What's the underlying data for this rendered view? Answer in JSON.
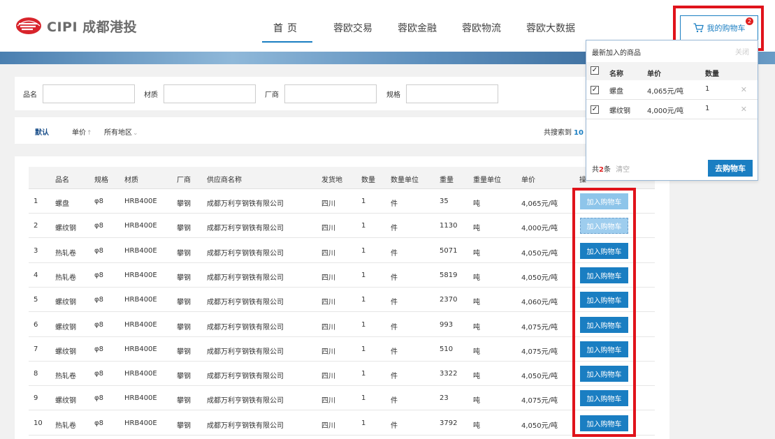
{
  "brand": {
    "name": "CIPI 成都港投"
  },
  "nav": {
    "items": [
      "首页",
      "蓉欧交易",
      "蓉欧金融",
      "蓉欧物流",
      "蓉欧大数据"
    ]
  },
  "cart": {
    "label": "我的购物车",
    "count": "2"
  },
  "search": {
    "fields": [
      {
        "label": "品名",
        "value": ""
      },
      {
        "label": "材质",
        "value": ""
      },
      {
        "label": "厂商",
        "value": ""
      },
      {
        "label": "规格",
        "value": ""
      }
    ]
  },
  "sort": {
    "default": "默认",
    "price": "单价",
    "region": "所有地区",
    "count_prefix": "共搜索到",
    "count": "10"
  },
  "table": {
    "headers": [
      "品名",
      "规格",
      "材质",
      "厂商",
      "供应商名称",
      "发货地",
      "数量",
      "数量单位",
      "重量",
      "重量单位",
      "单价",
      "操"
    ],
    "add_label": "加入购物车",
    "rows": [
      {
        "no": "1",
        "name": "螺盘",
        "spec": "φ8",
        "material": "HRB400E",
        "maker": "攀钢",
        "supplier": "成都万利亨钢铁有限公司",
        "origin": "四川",
        "qty": "1",
        "qty_unit": "件",
        "weight": "35",
        "weight_unit": "吨",
        "price": "4,065元/吨"
      },
      {
        "no": "2",
        "name": "螺纹钢",
        "spec": "φ8",
        "material": "HRB400E",
        "maker": "攀钢",
        "supplier": "成都万利亨钢铁有限公司",
        "origin": "四川",
        "qty": "1",
        "qty_unit": "件",
        "weight": "1130",
        "weight_unit": "吨",
        "price": "4,000元/吨"
      },
      {
        "no": "3",
        "name": "热轧卷",
        "spec": "φ8",
        "material": "HRB400E",
        "maker": "攀钢",
        "supplier": "成都万利亨钢铁有限公司",
        "origin": "四川",
        "qty": "1",
        "qty_unit": "件",
        "weight": "5071",
        "weight_unit": "吨",
        "price": "4,050元/吨"
      },
      {
        "no": "4",
        "name": "热轧卷",
        "spec": "φ8",
        "material": "HRB400E",
        "maker": "攀钢",
        "supplier": "成都万利亨钢铁有限公司",
        "origin": "四川",
        "qty": "1",
        "qty_unit": "件",
        "weight": "5819",
        "weight_unit": "吨",
        "price": "4,050元/吨"
      },
      {
        "no": "5",
        "name": "螺纹钢",
        "spec": "φ8",
        "material": "HRB400E",
        "maker": "攀钢",
        "supplier": "成都万利亨钢铁有限公司",
        "origin": "四川",
        "qty": "1",
        "qty_unit": "件",
        "weight": "2370",
        "weight_unit": "吨",
        "price": "4,060元/吨"
      },
      {
        "no": "6",
        "name": "螺纹钢",
        "spec": "φ8",
        "material": "HRB400E",
        "maker": "攀钢",
        "supplier": "成都万利亨钢铁有限公司",
        "origin": "四川",
        "qty": "1",
        "qty_unit": "件",
        "weight": "993",
        "weight_unit": "吨",
        "price": "4,075元/吨"
      },
      {
        "no": "7",
        "name": "螺纹钢",
        "spec": "φ8",
        "material": "HRB400E",
        "maker": "攀钢",
        "supplier": "成都万利亨钢铁有限公司",
        "origin": "四川",
        "qty": "1",
        "qty_unit": "件",
        "weight": "510",
        "weight_unit": "吨",
        "price": "4,075元/吨"
      },
      {
        "no": "8",
        "name": "热轧卷",
        "spec": "φ8",
        "material": "HRB400E",
        "maker": "攀钢",
        "supplier": "成都万利亨钢铁有限公司",
        "origin": "四川",
        "qty": "1",
        "qty_unit": "件",
        "weight": "3322",
        "weight_unit": "吨",
        "price": "4,050元/吨"
      },
      {
        "no": "9",
        "name": "螺纹钢",
        "spec": "φ8",
        "material": "HRB400E",
        "maker": "攀钢",
        "supplier": "成都万利亨钢铁有限公司",
        "origin": "四川",
        "qty": "1",
        "qty_unit": "件",
        "weight": "23",
        "weight_unit": "吨",
        "price": "4,075元/吨"
      },
      {
        "no": "10",
        "name": "热轧卷",
        "spec": "φ8",
        "material": "HRB400E",
        "maker": "攀钢",
        "supplier": "成都万利亨钢铁有限公司",
        "origin": "四川",
        "qty": "1",
        "qty_unit": "件",
        "weight": "3792",
        "weight_unit": "吨",
        "price": "4,050元/吨"
      }
    ]
  },
  "popup": {
    "title": "最新加入的商品",
    "close": "关闭",
    "headers": [
      "名称",
      "单价",
      "数量"
    ],
    "items": [
      {
        "name": "螺盘",
        "price": "4,065元/吨",
        "qty": "1"
      },
      {
        "name": "螺纹钢",
        "price": "4,000元/吨",
        "qty": "1"
      }
    ],
    "footer_prefix": "共",
    "footer_count": "2",
    "footer_suffix": "条",
    "clear": "清空",
    "goto": "去购物车"
  },
  "colors": {
    "accent": "#1a7ec2",
    "highlight": "#e0131b"
  },
  "icons": {
    "cart": "cart-icon",
    "remove": "close-icon"
  }
}
